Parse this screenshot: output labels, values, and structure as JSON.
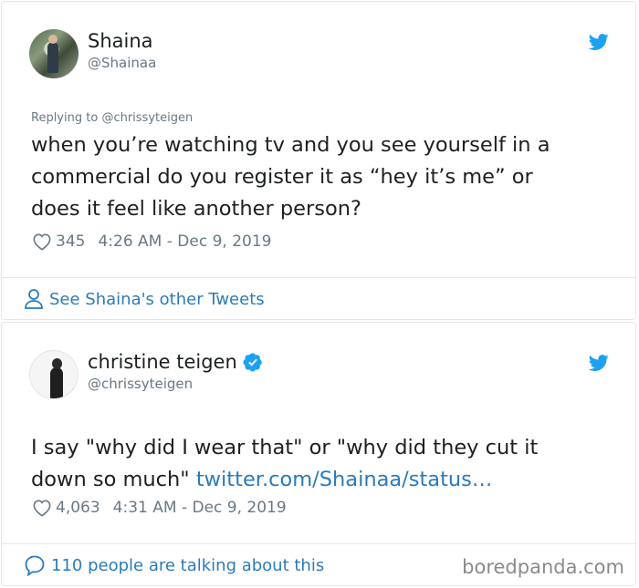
{
  "tweet1": {
    "author_name": "Shaina",
    "author_handle": "@Shainaa",
    "replying_prefix": "Replying to",
    "replying_handle": "@chrissyteigen",
    "lines": [
      "when you’re watching tv and you see yourself in a",
      "commercial do you register it as “hey it’s me” or",
      "does it feel like another person?"
    ],
    "likes": "345",
    "timestamp": "4:26 AM - Dec 9, 2019",
    "footer_link": "See Shaina's other Tweets"
  },
  "tweet2": {
    "author_name": "christine teigen",
    "author_handle": "@chrissyteigen",
    "verified": true,
    "line1": "I say \"why did I wear that\" or \"why did they cut it",
    "line2_text": "down so much\" ",
    "line2_link": "twitter.com/Shainaa/status…",
    "likes": "4,063",
    "timestamp": "4:31 AM - Dec 9, 2019",
    "footer_link": "110 people are talking about this"
  },
  "watermark": "boredpanda.com",
  "colors": {
    "link": "#2b7bb9",
    "twitter_blue": "#1da1f2",
    "meta_gray": "#697882",
    "border": "#e1e8ed"
  },
  "icons": [
    "twitter-bird-icon",
    "heart-icon",
    "person-icon",
    "speech-bubble-icon",
    "verified-badge-icon"
  ]
}
